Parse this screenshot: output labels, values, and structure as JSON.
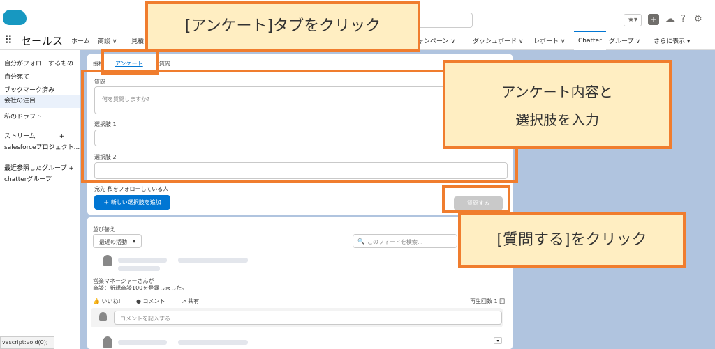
{
  "header": {
    "app_name": "セールス"
  },
  "nav": {
    "items": [
      "ホーム",
      "商談",
      "見積",
      "ャンペーン",
      "ダッシュボード",
      "レポート",
      "Chatter",
      "グループ",
      "さらに表示"
    ]
  },
  "sidebar": {
    "items": [
      "自分がフォローするもの",
      "自分宛て",
      "ブックマーク済み",
      "会社の注目",
      "私のドラフト",
      "ストリーム",
      "salesforceプロジェクト...",
      "最近参照したグループ",
      "chatterグループ"
    ],
    "selected": "会社の注目"
  },
  "publisher": {
    "tabs": [
      "投稿",
      "アンケート",
      "質問"
    ],
    "question_label": "質問",
    "question_placeholder": "何を質問しますか?",
    "choice1_label": "選択肢 1",
    "choice2_label": "選択肢 2",
    "to_label": "宛先",
    "to_value": "私をフォローしている人",
    "add_choice_button": "＋ 新しい選択肢を追加",
    "ask_button": "質問する"
  },
  "feed": {
    "sort_label": "並び替え",
    "sort_value": "最近の活動",
    "search_placeholder": "このフィードを検索...",
    "post_line1": "営業マネージャーさんが",
    "post_line2": "商談：新規商談100を登録しました。",
    "like": "いいね!",
    "comment": "コメント",
    "share": "共有",
    "views": "再生回数 1 回",
    "comment_placeholder": "コメントを記入する..."
  },
  "annotations": {
    "a1": "[アンケート]タブをクリック",
    "a2_line1": "アンケート内容と",
    "a2_line2": "選択肢を入力",
    "a3": "[質問する]をクリック"
  },
  "status_bar": "vascript:void(0);"
}
